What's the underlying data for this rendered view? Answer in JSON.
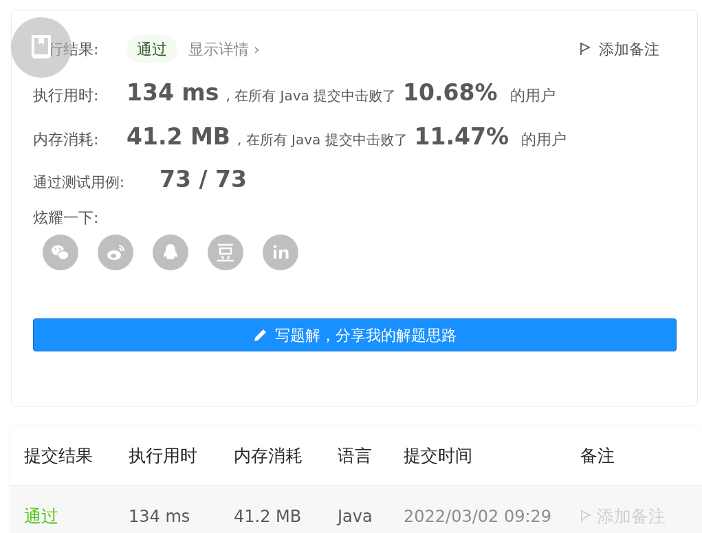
{
  "result": {
    "label": "行结果:",
    "status": "通过",
    "details_link": "显示详情 ›",
    "add_note": "添加备注"
  },
  "stats": [
    {
      "label": "执行用时:",
      "value": "134 ms",
      "mid": ", 在所有 Java 提交中击败了",
      "percent": "10.68%",
      "suffix": "的用户"
    },
    {
      "label": "内存消耗:",
      "value": "41.2 MB",
      "mid": ", 在所有 Java 提交中击败了",
      "percent": "11.47%",
      "suffix": "的用户"
    }
  ],
  "tests": {
    "label": "通过测试用例:",
    "passed": "73",
    "sep": "/",
    "total": "73"
  },
  "share": {
    "label": "炫耀一下:",
    "icons": [
      {
        "kind": "wechat"
      },
      {
        "kind": "weibo"
      },
      {
        "kind": "qq"
      },
      {
        "kind": "douban"
      },
      {
        "kind": "linkedin"
      }
    ]
  },
  "write_button": "写题解，分享我的解题思路",
  "floating_button": {
    "kind": "bookmark"
  },
  "table": {
    "columns": [
      "提交结果",
      "执行用时",
      "内存消耗",
      "语言",
      "提交时间",
      "备注"
    ],
    "rows": [
      {
        "status": "通过",
        "runtime": "134 ms",
        "memory": "41.2 MB",
        "language": "Java",
        "time": "2022/03/02 09:29",
        "note": "添加备注"
      }
    ]
  }
}
